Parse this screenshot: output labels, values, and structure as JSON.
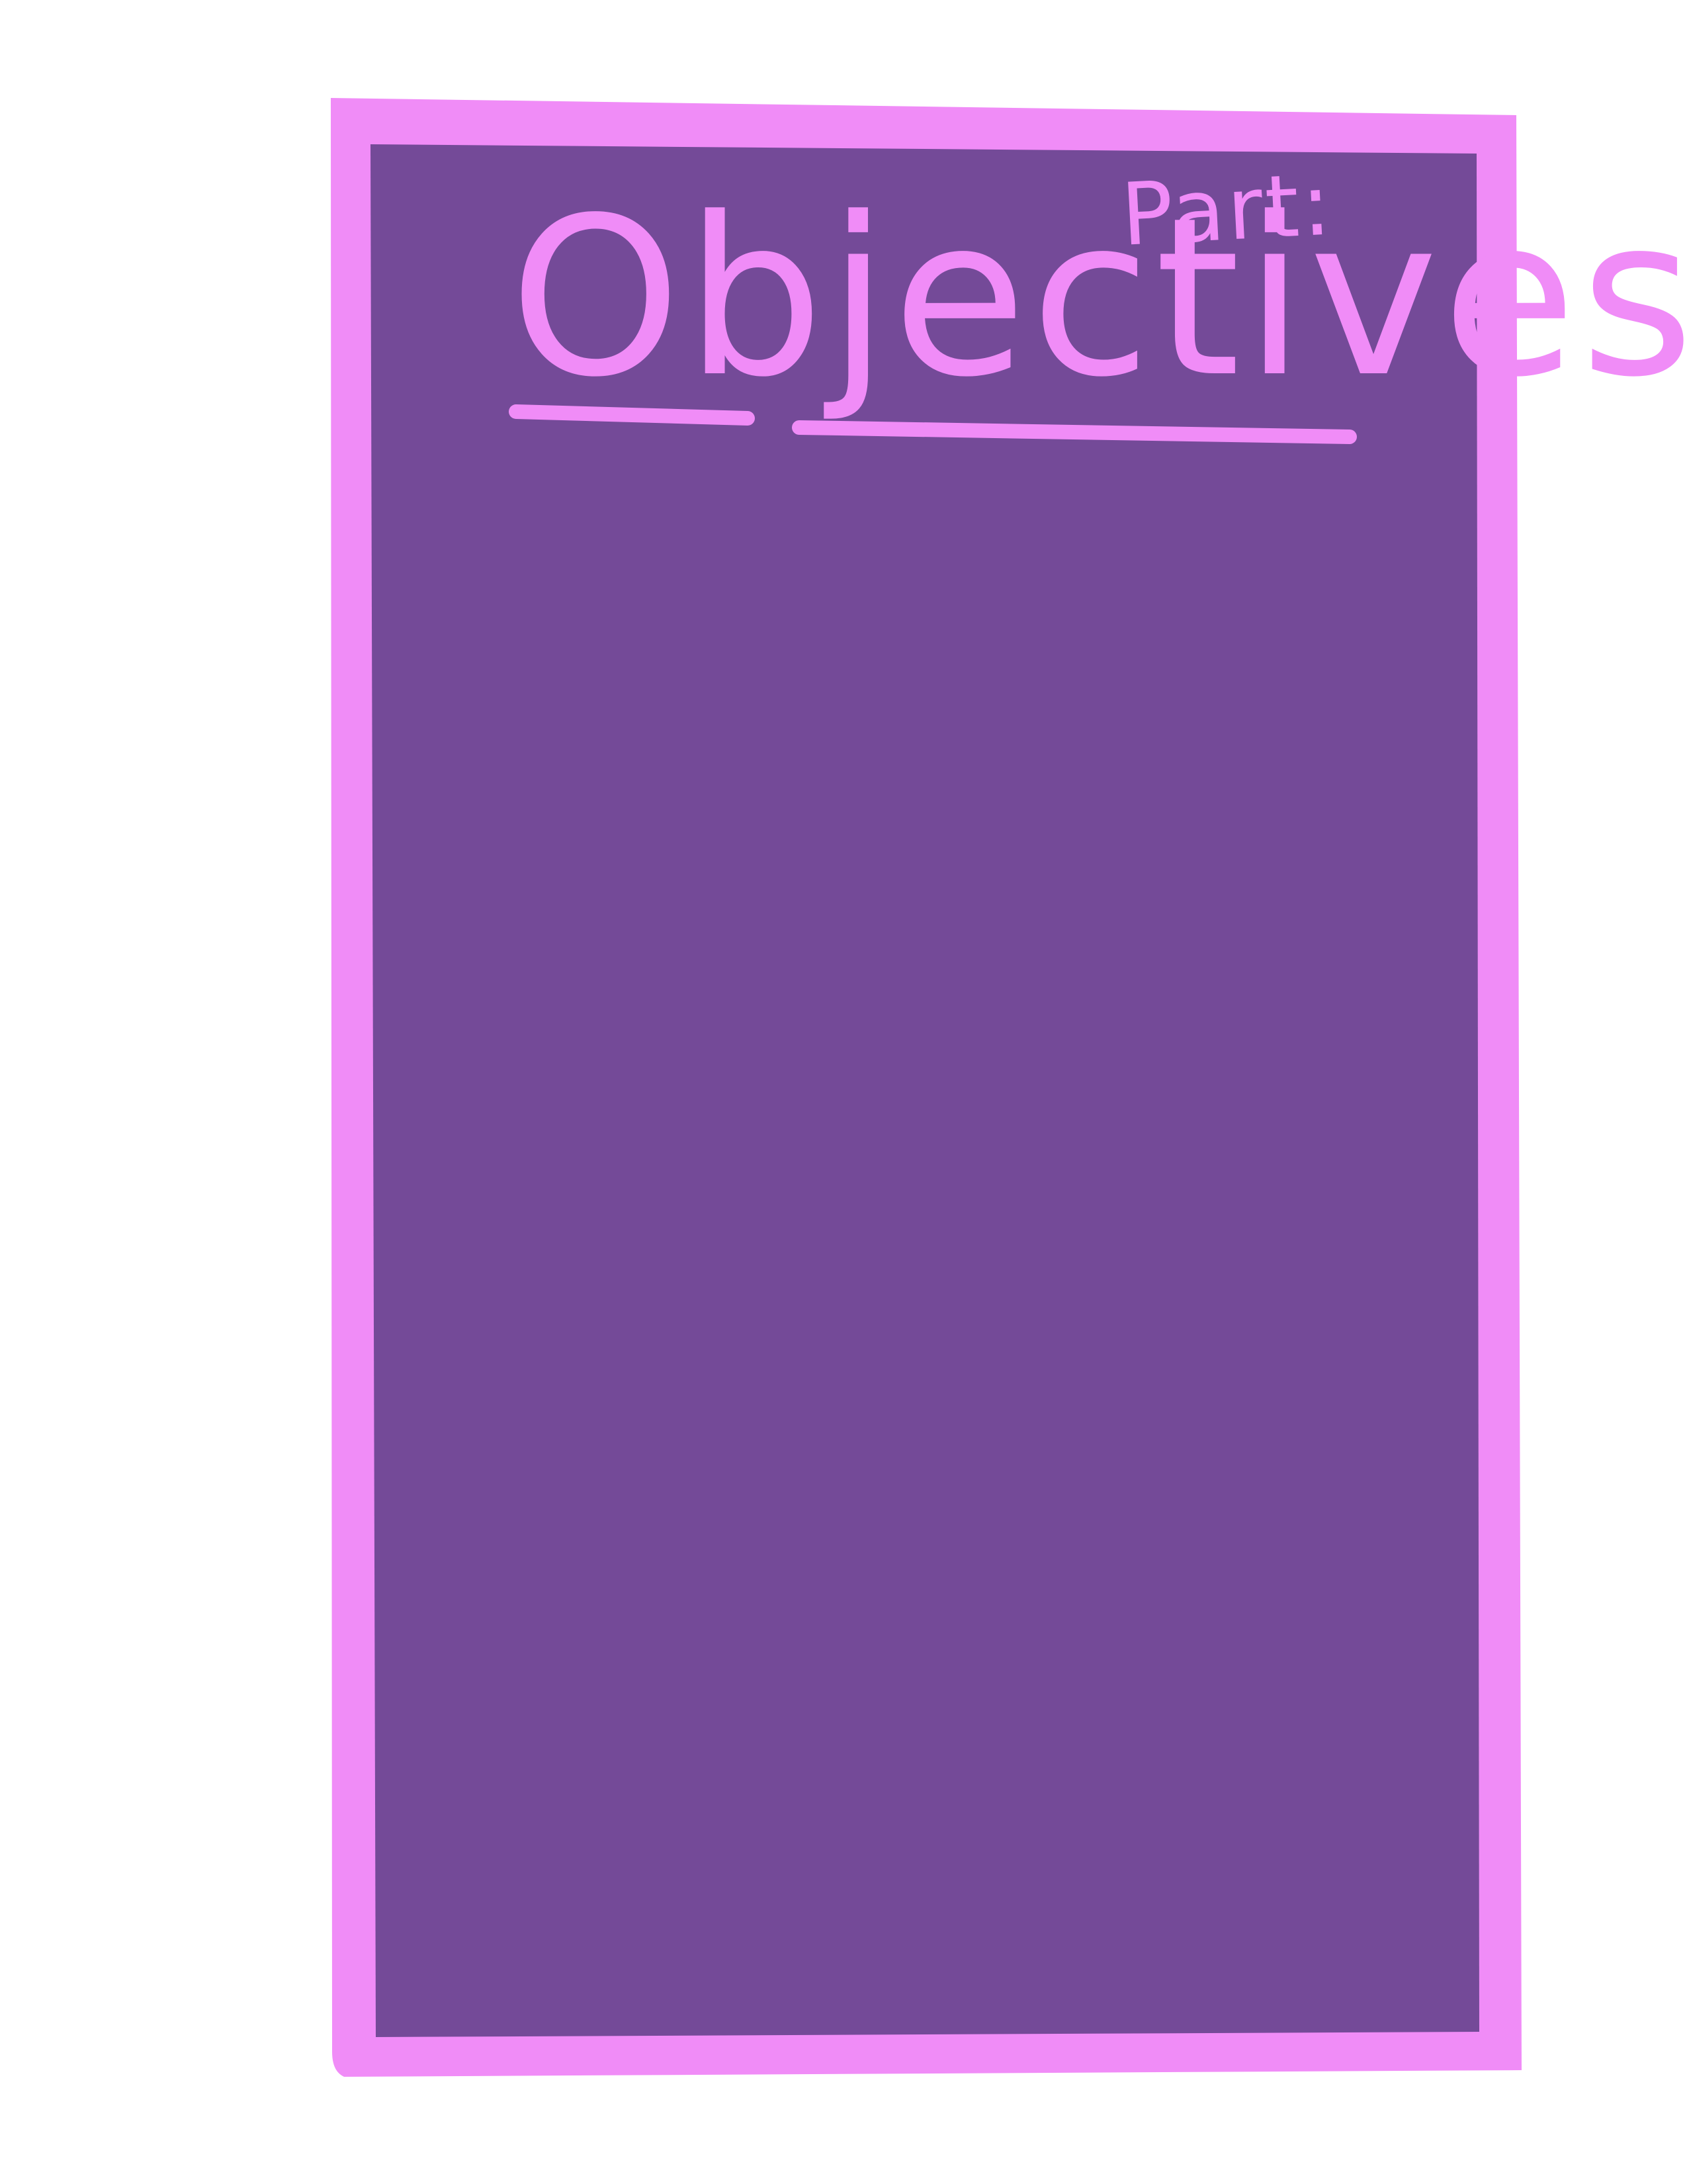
{
  "sheet": {
    "part_label": "Part:",
    "title": "Objectives",
    "colors": {
      "border": "#f08cf7",
      "panel": "#744a98",
      "page": "#ffffff",
      "ink": "#f08cf7"
    }
  }
}
